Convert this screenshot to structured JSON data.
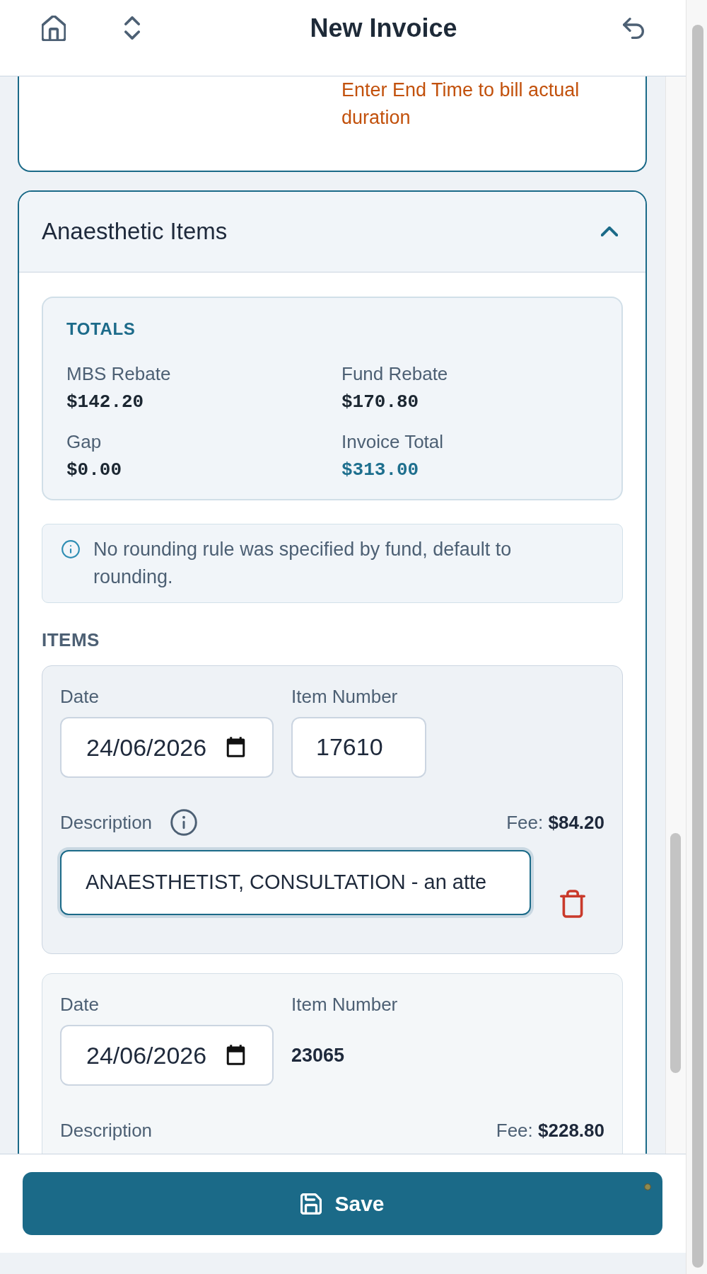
{
  "header": {
    "title": "New Invoice"
  },
  "time_card": {
    "warning": "Enter End Time to bill actual duration"
  },
  "anaesthetic_section": {
    "title": "Anaesthetic Items",
    "expanded": true,
    "totals": {
      "heading": "TOTALS",
      "fields": [
        {
          "label": "MBS Rebate",
          "value": "$142.20",
          "highlighted": false
        },
        {
          "label": "Fund Rebate",
          "value": "$170.80",
          "highlighted": false
        },
        {
          "label": "Gap",
          "value": "$0.00",
          "highlighted": false
        },
        {
          "label": "Invoice Total",
          "value": "$313.00",
          "highlighted": true
        }
      ]
    },
    "notice": "No rounding rule was specified by fund, default to rounding.",
    "items_heading": "ITEMS",
    "items": [
      {
        "kind": "edit",
        "date_label": "Date",
        "date": "24/06/2026",
        "item_number_label": "Item Number",
        "item_number": "17610",
        "description_label": "Description",
        "fee": "Fee: **$84.20**",
        "description": {
          "value": "ANAESTHETIST, CONSULTATION - an atte",
          "focused": true
        }
      },
      {
        "kind": "view",
        "date_label": "Date",
        "date": "24/06/2026",
        "item_number_label": "Item Number",
        "item_number": "23065",
        "description_label": "Description",
        "fee": "Fee: **$228.80**"
      }
    ]
  },
  "footer": {
    "save_label": "Save"
  }
}
